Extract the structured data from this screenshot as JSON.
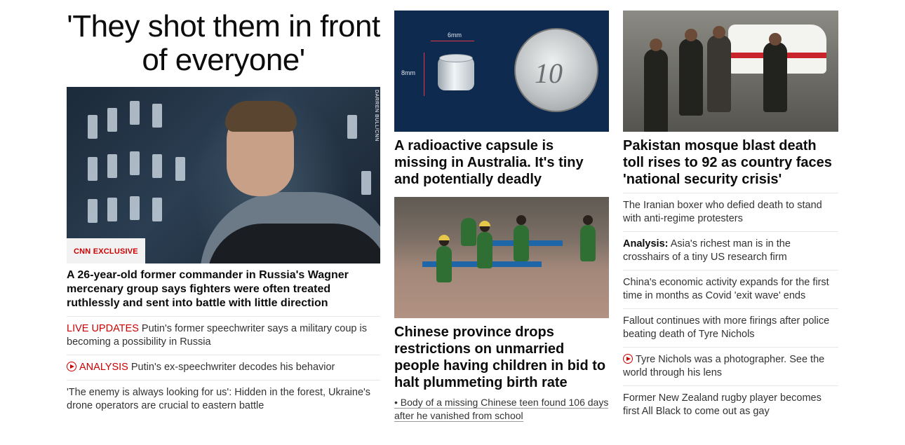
{
  "left": {
    "hero_title": "'They shot them in front of everyone'",
    "photo_credit": "DARREN BULL/CNN",
    "badge": "CNN EXCLUSIVE",
    "lead_headline": "A 26-year-old former commander in Russia's Wagner mercenary group says fighters were often treated ruthlessly and sent into battle with little direction",
    "items": [
      {
        "kicker": "LIVE UPDATES",
        "text": " Putin's former speechwriter says a military coup is becoming a possibility in Russia"
      },
      {
        "kicker": "ANALYSIS",
        "text": " Putin's ex-speechwriter decodes his behavior"
      },
      {
        "kicker": "",
        "text": "'The enemy is always looking for us': Hidden in the forest, Ukraine's drone operators are crucial to eastern battle"
      }
    ]
  },
  "middle": {
    "capsule_dim_width": "6mm",
    "capsule_dim_height": "8mm",
    "capsule_coin_text": "10",
    "capsule_headline": "A radioactive capsule is missing in Australia. It's tiny and potentially deadly",
    "china_headline": "Chinese province drops restrictions on unmarried people having children in bid to halt plummeting birth rate",
    "china_related": "• Body of a missing Chinese teen found 106 days after he vanished from school"
  },
  "right": {
    "pakistan_headline": "Pakistan mosque blast death toll rises to 92 as country faces 'national security crisis'",
    "items": [
      {
        "bold": "",
        "text": "The Iranian boxer who defied death to stand with anti-regime protesters"
      },
      {
        "bold": "Analysis:",
        "text": " Asia's richest man is in the crosshairs of a tiny US research firm"
      },
      {
        "bold": "",
        "text": "China's economic activity expands for the first time in months as Covid 'exit wave' ends"
      },
      {
        "bold": "",
        "text": "Fallout continues with more firings after police beating death of Tyre Nichols"
      },
      {
        "bold": "",
        "text": "Tyre Nichols was a photographer. See the world through his lens",
        "video": true
      },
      {
        "bold": "",
        "text": "Former New Zealand rugby player becomes first All Black to come out as gay"
      }
    ]
  }
}
